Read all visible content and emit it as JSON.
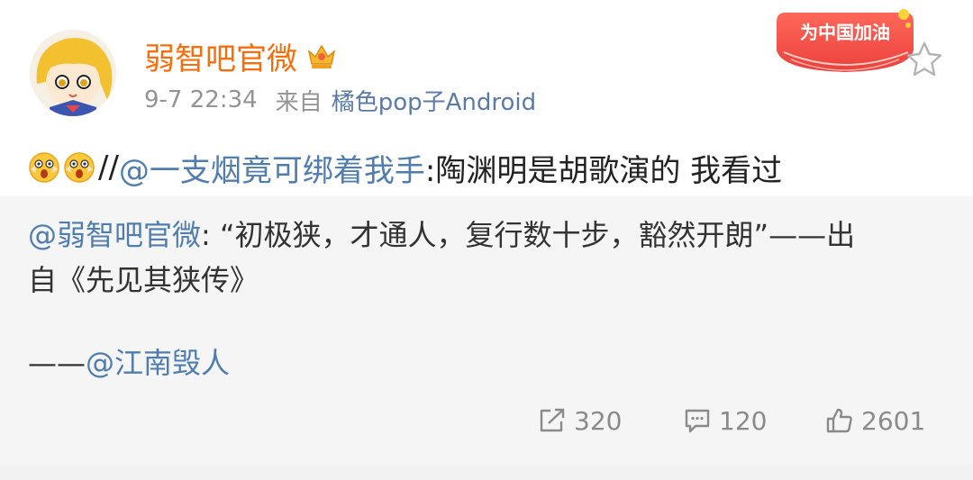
{
  "post": {
    "author": {
      "name": "弱智吧官微",
      "avatar_icon": "avatar-cartoon-girl",
      "verified_icon": "crown-badge-icon"
    },
    "meta": {
      "time": "9-7 22:34",
      "from_label": "来自",
      "source": "橘色pop子Android"
    },
    "badge_text": "为中国加油",
    "repost": {
      "emojis": [
        "shocked-face-icon",
        "shocked-face-icon"
      ],
      "separator": "//",
      "mention": "@一支烟竟可绑着我手",
      "text": ":陶渊明是胡歌演的 我看过"
    },
    "quoted": {
      "mention": "@弱智吧官微",
      "line1_text": ": “初极狭，才通人，复行数十步，豁然开朗”——出",
      "line2_text": "自《先见其狭传》",
      "signature_prefix": "——",
      "signature_mention": "@江南毁人"
    },
    "actions": {
      "repost_count": "320",
      "comment_count": "120",
      "like_count": "2601"
    }
  },
  "colors": {
    "username": "#f86e0c",
    "mention": "#4f7db0",
    "source": "#5b7aa8",
    "meta": "#939393",
    "quoted_bg": "#f5f5f5",
    "action": "#8a8a8a"
  }
}
